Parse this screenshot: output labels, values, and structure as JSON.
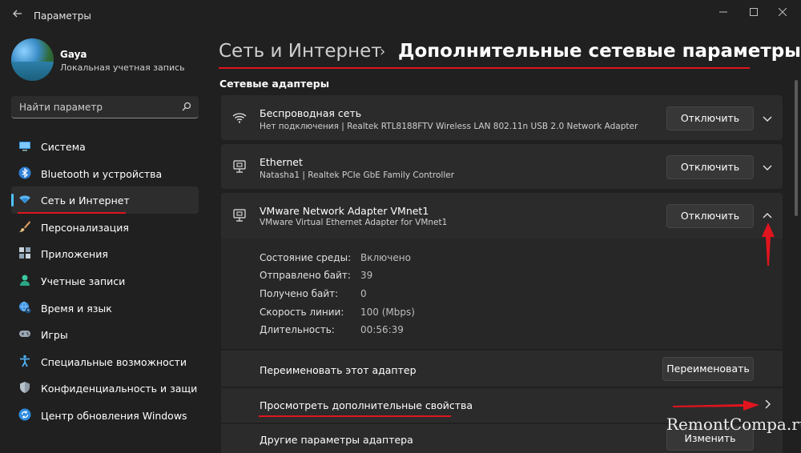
{
  "window": {
    "title": "Параметры"
  },
  "user": {
    "name": "Gaya",
    "account_type": "Локальная учетная запись"
  },
  "search": {
    "placeholder": "Найти параметр"
  },
  "nav": {
    "items": [
      {
        "label": "Система",
        "icon": "monitor-icon",
        "active": false
      },
      {
        "label": "Bluetooth и устройства",
        "icon": "bluetooth-icon",
        "active": false
      },
      {
        "label": "Сеть и Интернет",
        "icon": "wifi-icon",
        "active": true
      },
      {
        "label": "Персонализация",
        "icon": "brush-icon",
        "active": false
      },
      {
        "label": "Приложения",
        "icon": "apps-icon",
        "active": false
      },
      {
        "label": "Учетные записи",
        "icon": "person-icon",
        "active": false
      },
      {
        "label": "Время и язык",
        "icon": "globe-clock-icon",
        "active": false
      },
      {
        "label": "Игры",
        "icon": "gamepad-icon",
        "active": false
      },
      {
        "label": "Специальные возможности",
        "icon": "accessibility-icon",
        "active": false
      },
      {
        "label": "Конфиденциальность и защита",
        "icon": "shield-icon",
        "active": false
      },
      {
        "label": "Центр обновления Windows",
        "icon": "update-icon",
        "active": false
      }
    ]
  },
  "breadcrumb": {
    "parent": "Сеть и Интернет",
    "separator": "›",
    "current": "Дополнительные сетевые параметры"
  },
  "section": {
    "title": "Сетевые адаптеры"
  },
  "adapters": [
    {
      "name": "Беспроводная сеть",
      "description": "Нет подключения | Realtek RTL8188FTV Wireless LAN 802.11n USB 2.0 Network Adapter",
      "button": "Отключить",
      "icon": "wifi-icon"
    },
    {
      "name": "Ethernet",
      "description": "Natasha1 | Realtek PCIe GbE Family Controller",
      "button": "Отключить",
      "icon": "ethernet-icon"
    },
    {
      "name": "VMware Network Adapter VMnet1",
      "description": "VMware Virtual Ethernet Adapter for VMnet1",
      "button": "Отключить",
      "icon": "ethernet-icon"
    }
  ],
  "details": [
    {
      "label": "Состояние среды:",
      "value": "Включено"
    },
    {
      "label": "Отправлено байт:",
      "value": "39"
    },
    {
      "label": "Получено байт:",
      "value": "0"
    },
    {
      "label": "Скорость линии:",
      "value": "100 (Mbps)"
    },
    {
      "label": "Длительность:",
      "value": "00:56:39"
    }
  ],
  "actions": {
    "rename_label": "Переименовать этот адаптер",
    "rename_button": "Переименовать",
    "view_props_label": "Просмотреть дополнительные свойства",
    "other_label": "Другие параметры адаптера",
    "other_button": "Изменить"
  },
  "watermark": "RemontCompa.ru",
  "colors": {
    "accent": "#4cc2ff",
    "annotation_red": "#e0141e",
    "background": "#202020",
    "card": "#2b2b2b"
  }
}
